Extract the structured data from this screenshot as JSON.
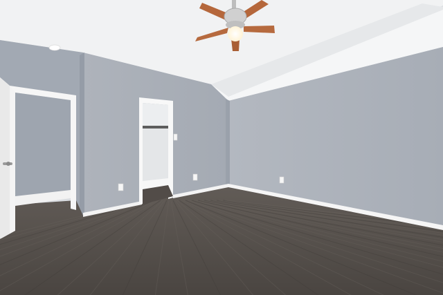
{
  "scene": {
    "description_free": true,
    "colors": {
      "ceiling": "#f2f3f4",
      "ceiling_slope": "#e9ebed",
      "wall_main": "#a9afb8",
      "wall_left": "#9fa6b0",
      "wall_shadow": "#8f96a1",
      "trim": "#f7f7f7",
      "floor_dark": "#3f3b38",
      "floor_mid": "#5a5551",
      "floor_light": "#726c67",
      "fan_blade": "#b5653a",
      "fan_metal": "#c9c9c9",
      "fan_light": "#fff6e0"
    },
    "objects": [
      "ceiling-fan",
      "open-door",
      "closet-doorway",
      "outlets",
      "light-switch",
      "smoke-detector",
      "laminate-floor"
    ]
  }
}
